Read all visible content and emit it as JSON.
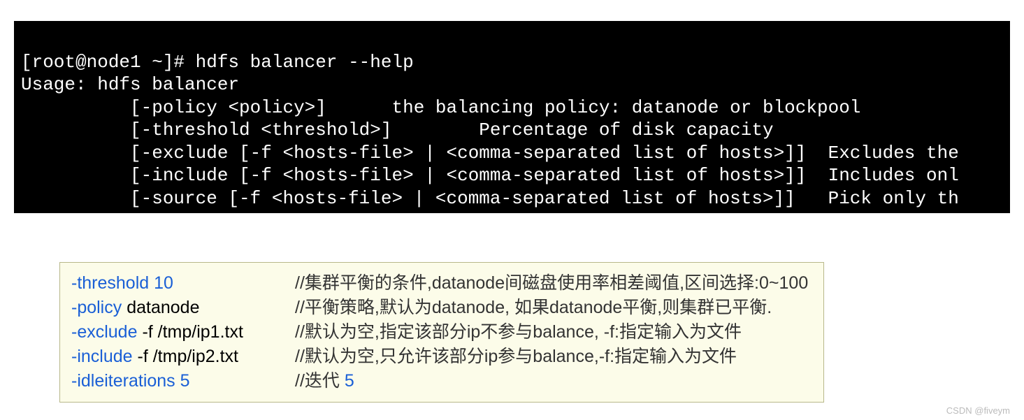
{
  "terminal": {
    "line1": "[root@node1 ~]# hdfs balancer --help",
    "line2": "Usage: hdfs balancer",
    "line3": "          [-policy <policy>]      the balancing policy: datanode or blockpool",
    "line4": "          [-threshold <threshold>]        Percentage of disk capacity",
    "line5": "          [-exclude [-f <hosts-file> | <comma-separated list of hosts>]]  Excludes the",
    "line6": "          [-include [-f <hosts-file> | <comma-separated list of hosts>]]  Includes onl",
    "line7": "          [-source [-f <hosts-file> | <comma-separated list of hosts>]]   Pick only th"
  },
  "notes": {
    "rows": [
      {
        "flag": "-threshold",
        "arg": "  10",
        "argClass": "num",
        "comment": "//集群平衡的条件,datanode间磁盘使用率相差阈值,区间选择:0~100"
      },
      {
        "flag": "-policy",
        "arg": " datanode",
        "argClass": "",
        "comment": "//平衡策略,默认为datanode, 如果datanode平衡,则集群已平衡."
      },
      {
        "flag": "-exclude",
        "arg": "  -f  /tmp/ip1.txt",
        "argClass": "",
        "comment": "//默认为空,指定该部分ip不参与balance, -f:指定输入为文件"
      },
      {
        "flag": "-include",
        "arg": "  -f  /tmp/ip2.txt",
        "argClass": "",
        "comment": "//默认为空,只允许该部分ip参与balance,-f:指定输入为文件"
      },
      {
        "flag": "-idleiterations",
        "arg": "  5",
        "argClass": "num",
        "comment": "//迭代  5"
      }
    ]
  },
  "footer": "CSDN @fiveym"
}
